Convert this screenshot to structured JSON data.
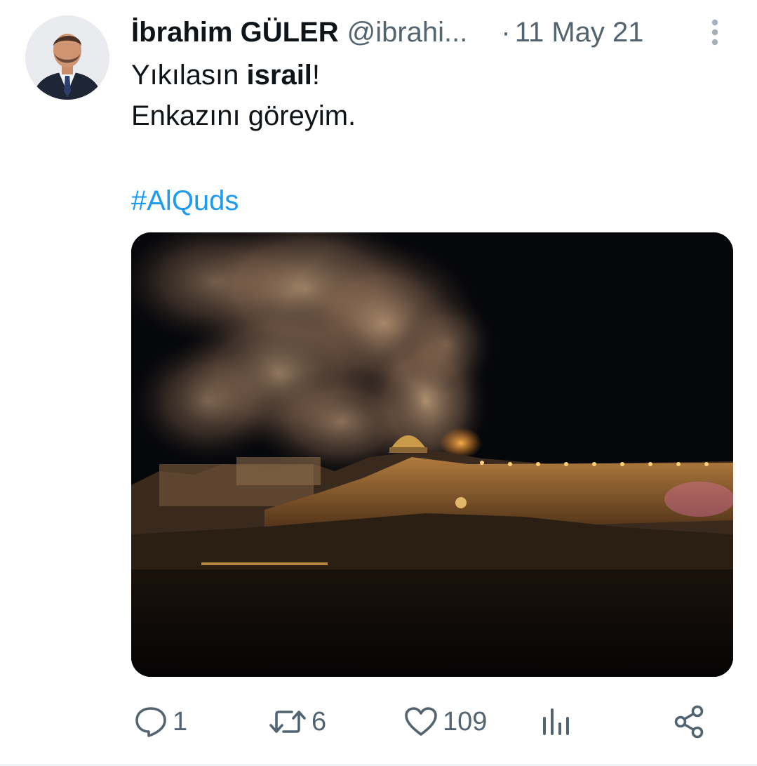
{
  "tweet": {
    "author": {
      "display_name": "İbrahim GÜLER",
      "handle": "@ibrahi...",
      "avatar_icon": "profile-photo"
    },
    "separator": "·",
    "date": "11 May 21",
    "more_icon": "vertical-ellipsis-icon",
    "text": {
      "line1_before": "Yıkılasın ",
      "line1_bold": "israil",
      "line1_after": "!",
      "line2": "Enkazını göreyim."
    },
    "hashtag": "#AlQuds",
    "media": {
      "kind": "photo"
    },
    "actions": {
      "reply": {
        "icon": "reply-bubble-icon",
        "count": "1"
      },
      "retweet": {
        "icon": "retweet-icon",
        "count": "6"
      },
      "like": {
        "icon": "heart-icon",
        "count": "109"
      },
      "views": {
        "icon": "bar-chart-icon"
      },
      "share": {
        "icon": "share-icon"
      }
    }
  },
  "colors": {
    "text_primary": "#0f1419",
    "text_secondary": "#536471",
    "link": "#1d9bf0"
  }
}
